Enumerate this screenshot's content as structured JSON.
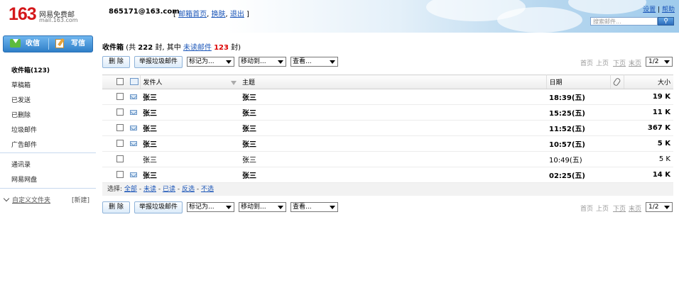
{
  "header": {
    "logo_num": "163",
    "logo_name": "网易免费邮",
    "logo_domain": "mail.163.com",
    "account": "865171@163.com",
    "bracket_open": "[",
    "link_home": "邮箱首页",
    "comma1": ",",
    "link_switch": "换肤",
    "comma2": ",",
    "link_logout": "退出",
    "bracket_close": "]",
    "link_settings": "设置",
    "top_sep": "|",
    "link_help": "帮助",
    "search_placeholder": "搜索邮件..."
  },
  "sidebar": {
    "receive": "收信",
    "write": "写信",
    "folders": [
      {
        "label": "收件箱(123)"
      },
      {
        "label": "草稿箱"
      },
      {
        "label": "已发送"
      },
      {
        "label": "已删除"
      },
      {
        "label": "垃圾邮件"
      },
      {
        "label": "广告邮件"
      }
    ],
    "extras": [
      {
        "label": "通讯录"
      },
      {
        "label": "网易网盘"
      }
    ],
    "custom_folders": "自定义文件夹",
    "new_folder": "[新建]"
  },
  "main": {
    "folder_title": "收件箱",
    "summary_prefix": "(共",
    "total": "222",
    "summary_mid": "封, 其中",
    "unread_link": "未读邮件",
    "unread_count": "123",
    "summary_suffix": "封)",
    "toolbar": {
      "delete": "删 除",
      "report_spam": "举报垃圾邮件",
      "mark_as": "标记为...",
      "move_to": "移动到...",
      "view": "查看..."
    },
    "pager": {
      "first": "首页",
      "prev": "上页",
      "next": "下页",
      "last": "末页",
      "page": "1/2"
    },
    "columns": {
      "sender": "发件人",
      "subject": "主题",
      "date": "日期",
      "size": "大小"
    },
    "rows": [
      {
        "sender": "张三",
        "subject": "张三",
        "date": "18:39(五)",
        "size": "19 K",
        "unread": true
      },
      {
        "sender": "张三",
        "subject": "张三",
        "date": "15:25(五)",
        "size": "11 K",
        "unread": true
      },
      {
        "sender": "张三",
        "subject": "张三",
        "date": "11:52(五)",
        "size": "367 K",
        "unread": true
      },
      {
        "sender": "张三",
        "subject": "张三",
        "date": "10:57(五)",
        "size": "5 K",
        "unread": true
      },
      {
        "sender": "张三",
        "subject": "张三",
        "date": "10:49(五)",
        "size": "5 K",
        "unread": false
      },
      {
        "sender": "张三",
        "subject": "张三",
        "date": "02:25(五)",
        "size": "14 K",
        "unread": true
      }
    ],
    "select_bar": {
      "label": "选择:",
      "all": "全部",
      "unread": "未读",
      "read": "已读",
      "invert": "反选",
      "none": "不选",
      "dash": "-"
    }
  },
  "colors": {
    "brand_red": "#d4171a",
    "link_blue": "#1a55b8",
    "button_blue": "#2f7fc8"
  }
}
